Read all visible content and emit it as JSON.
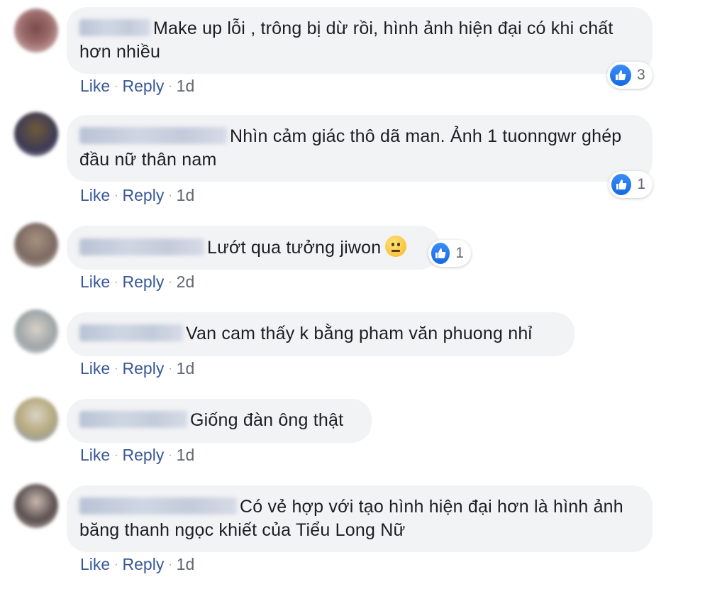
{
  "actions": {
    "like": "Like",
    "reply": "Reply",
    "separator": "·"
  },
  "comments": [
    {
      "text": "Make up lỗi , trông bị dừ rồi, hình ảnh hiện đại có khi chất hơn nhiều",
      "time": "1d",
      "likes": "3"
    },
    {
      "text": "Nhìn cảm giác thô dã man. Ảnh 1 tuonngwr ghép đầu nữ thân nam",
      "time": "1d",
      "likes": "1"
    },
    {
      "text": "Lướt qua tưởng jiwon",
      "emoji": "neutral-face-emoji",
      "time": "2d",
      "likes": "1"
    },
    {
      "text": "Van cam thấy k bằng pham văn phuong nhỉ",
      "time": "1d"
    },
    {
      "text": "Giống đàn ông thật",
      "time": "1d"
    },
    {
      "text": "Có vẻ hợp với tạo hình hiện đại hơn là hình ảnh băng thanh ngọc khiết của Tiểu Long Nữ",
      "time": "1d"
    }
  ],
  "colors": {
    "link": "#385898",
    "bubble": "#f2f3f5",
    "like_badge": "#1877f2"
  }
}
